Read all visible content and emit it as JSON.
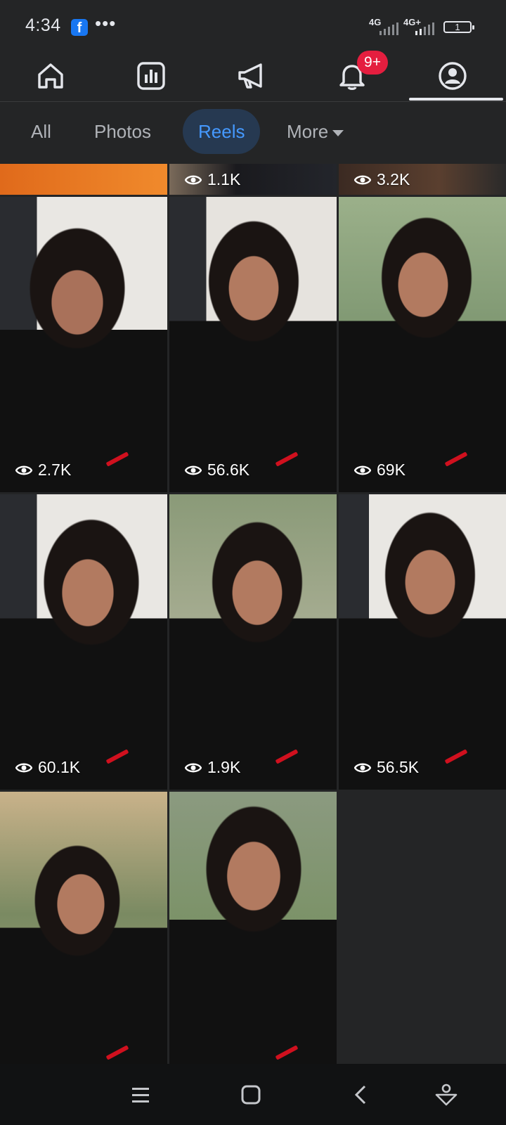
{
  "status": {
    "time": "4:34",
    "app_badge": "f",
    "more_dots": "•••",
    "net1": "4G",
    "net2": "4G+",
    "battery": "1"
  },
  "topnav": {
    "items": [
      "home-icon",
      "dashboard-icon",
      "megaphone-icon",
      "bell-icon",
      "profile-icon"
    ],
    "notification_count": "9+"
  },
  "tabs": {
    "all": "All",
    "photos": "Photos",
    "reels": "Reels",
    "more": "More"
  },
  "reels_top_partial": [
    {
      "views": ""
    },
    {
      "views": "1.1K"
    },
    {
      "views": "3.2K"
    }
  ],
  "reels": [
    {
      "views": "2.7K"
    },
    {
      "views": "56.6K"
    },
    {
      "views": "69K"
    },
    {
      "views": "60.1K"
    },
    {
      "views": "1.9K"
    },
    {
      "views": "56.5K"
    },
    {
      "views": ""
    },
    {
      "views": ""
    }
  ],
  "system_nav": [
    "menu-icon",
    "home-square-icon",
    "back-icon",
    "assistant-icon"
  ]
}
